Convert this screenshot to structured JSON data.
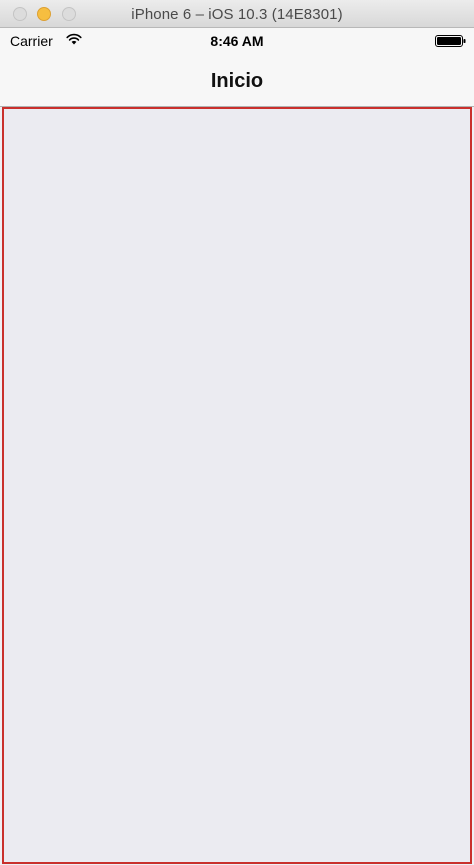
{
  "window": {
    "title": "iPhone 6 – iOS 10.3 (14E8301)"
  },
  "status_bar": {
    "carrier": "Carrier",
    "time": "8:46 AM",
    "icons": [
      "wifi-icon",
      "battery-icon"
    ]
  },
  "navigation": {
    "title": "Inicio"
  },
  "colors": {
    "content_background": "#ebebf1",
    "content_border": "#c9302c",
    "bar_background": "#f7f7f7",
    "minimize_button": "#f6be40"
  }
}
